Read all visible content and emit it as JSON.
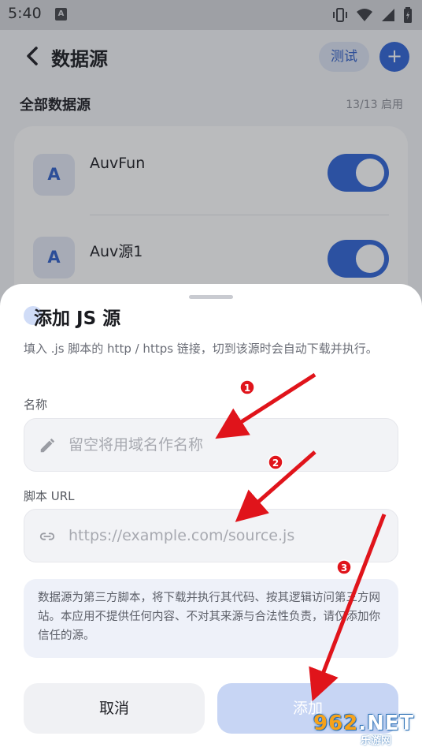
{
  "status_bar": {
    "time": "5:40",
    "notification_icon": "a-badge-icon",
    "right_icons": [
      "vibrate-icon",
      "wifi-icon",
      "signal-icon",
      "battery-icon"
    ]
  },
  "header": {
    "title": "数据源",
    "test_label": "测试",
    "add_icon": "plus-icon",
    "back_icon": "chevron-left-icon"
  },
  "section": {
    "title": "全部数据源",
    "count": "13/13 启用"
  },
  "sources": [
    {
      "avatar": "A",
      "name": "AuvFun",
      "enabled": true
    },
    {
      "avatar": "A",
      "name": "Auv源1",
      "enabled": true
    }
  ],
  "sheet": {
    "title": "添加 JS 源",
    "description": "填入 .js 脚本的 http / https 链接，切到该源时会自动下载并执行。",
    "name_label": "名称",
    "name_placeholder": "留空将用域名作名称",
    "name_value": "",
    "url_label": "脚本 URL",
    "url_placeholder": "https://example.com/source.js",
    "url_value": "",
    "notice": "数据源为第三方脚本，将下载并执行其代码、按其逻辑访问第三方网站。本应用不提供任何内容、不对其来源与合法性负责，请仅添加你信任的源。",
    "cancel_label": "取消",
    "submit_label": "添加"
  },
  "annotations": {
    "step1": "1",
    "step2": "2",
    "step3": "3"
  },
  "watermark": {
    "main": "962",
    "suffix": ".NET",
    "sub": "乐游网"
  },
  "colors": {
    "accent": "#2f63d6",
    "annotation_red": "#e0141b"
  }
}
